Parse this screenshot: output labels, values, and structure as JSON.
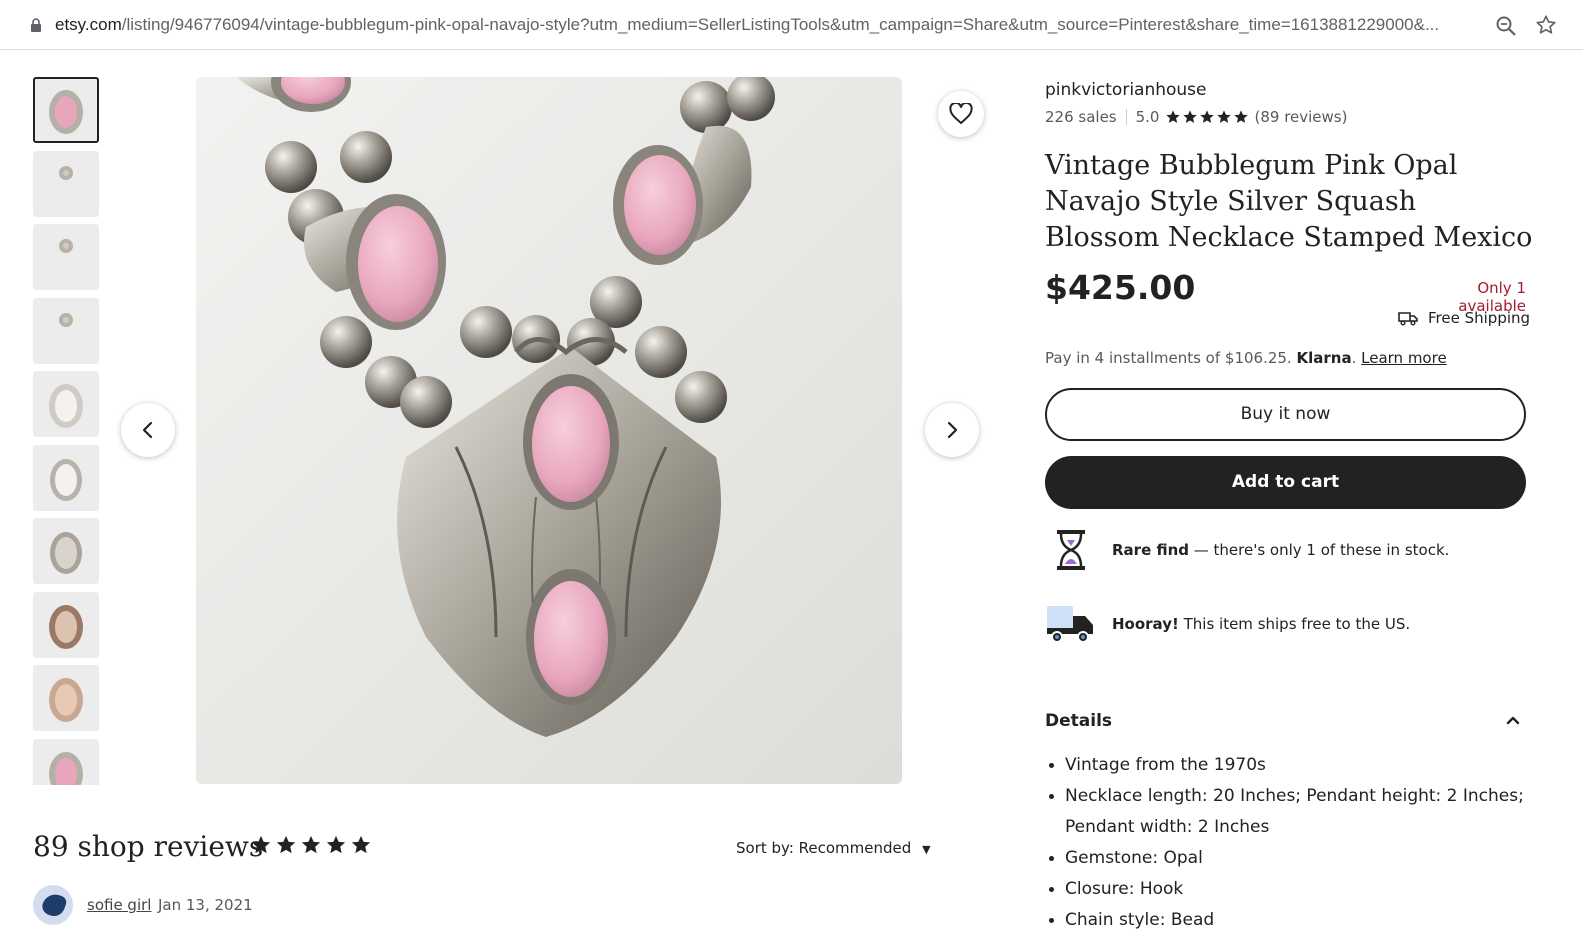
{
  "browser": {
    "url_host": "etsy.com",
    "url_path": "/listing/946776094/vintage-bubblegum-pink-opal-navajo-style?utm_medium=SellerListingTools&utm_campaign=Share&utm_source=Pinterest&share_time=1613881229000&..."
  },
  "gallery": {
    "thumbnail_count": 10,
    "selected_index": 0
  },
  "shop": {
    "name": "pinkvictorianhouse",
    "sales": "226 sales",
    "rating": "5.0",
    "reviews": "(89 reviews)",
    "star_count": 5
  },
  "listing": {
    "title": "Vintage Bubblegum Pink Opal Navajo Style Silver Squash Blossom Necklace Stamped Mexico",
    "price": "$425.00",
    "availability": "Only 1 available",
    "shipping": "Free Shipping",
    "klarna_text": "Pay in 4 installments of $106.25.",
    "klarna_brand": "Klarna",
    "klarna_link": "Learn more",
    "buy_now": "Buy it now",
    "add_to_cart": "Add to cart"
  },
  "perks": {
    "rare_bold": "Rare find",
    "rare_text": " — there's only 1 of these in stock.",
    "ship_bold": "Hooray!",
    "ship_text": " This item ships free to the US."
  },
  "details": {
    "heading": "Details",
    "items": [
      "Vintage from the 1970s",
      "Necklace length: 20 Inches; Pendant height: 2 Inches; Pendant width: 2 Inches",
      "Gemstone: Opal",
      "Closure: Hook",
      "Chain style: Bead"
    ]
  },
  "reviews": {
    "title": "89 shop reviews",
    "sort": "Sort by: Recommended",
    "first_reviewer": "sofie girl",
    "first_date": "Jan 13, 2021"
  },
  "colors": {
    "price_alert": "#a61a2e",
    "button_dark": "#222222",
    "opal_pink": "#e8a6bd"
  }
}
